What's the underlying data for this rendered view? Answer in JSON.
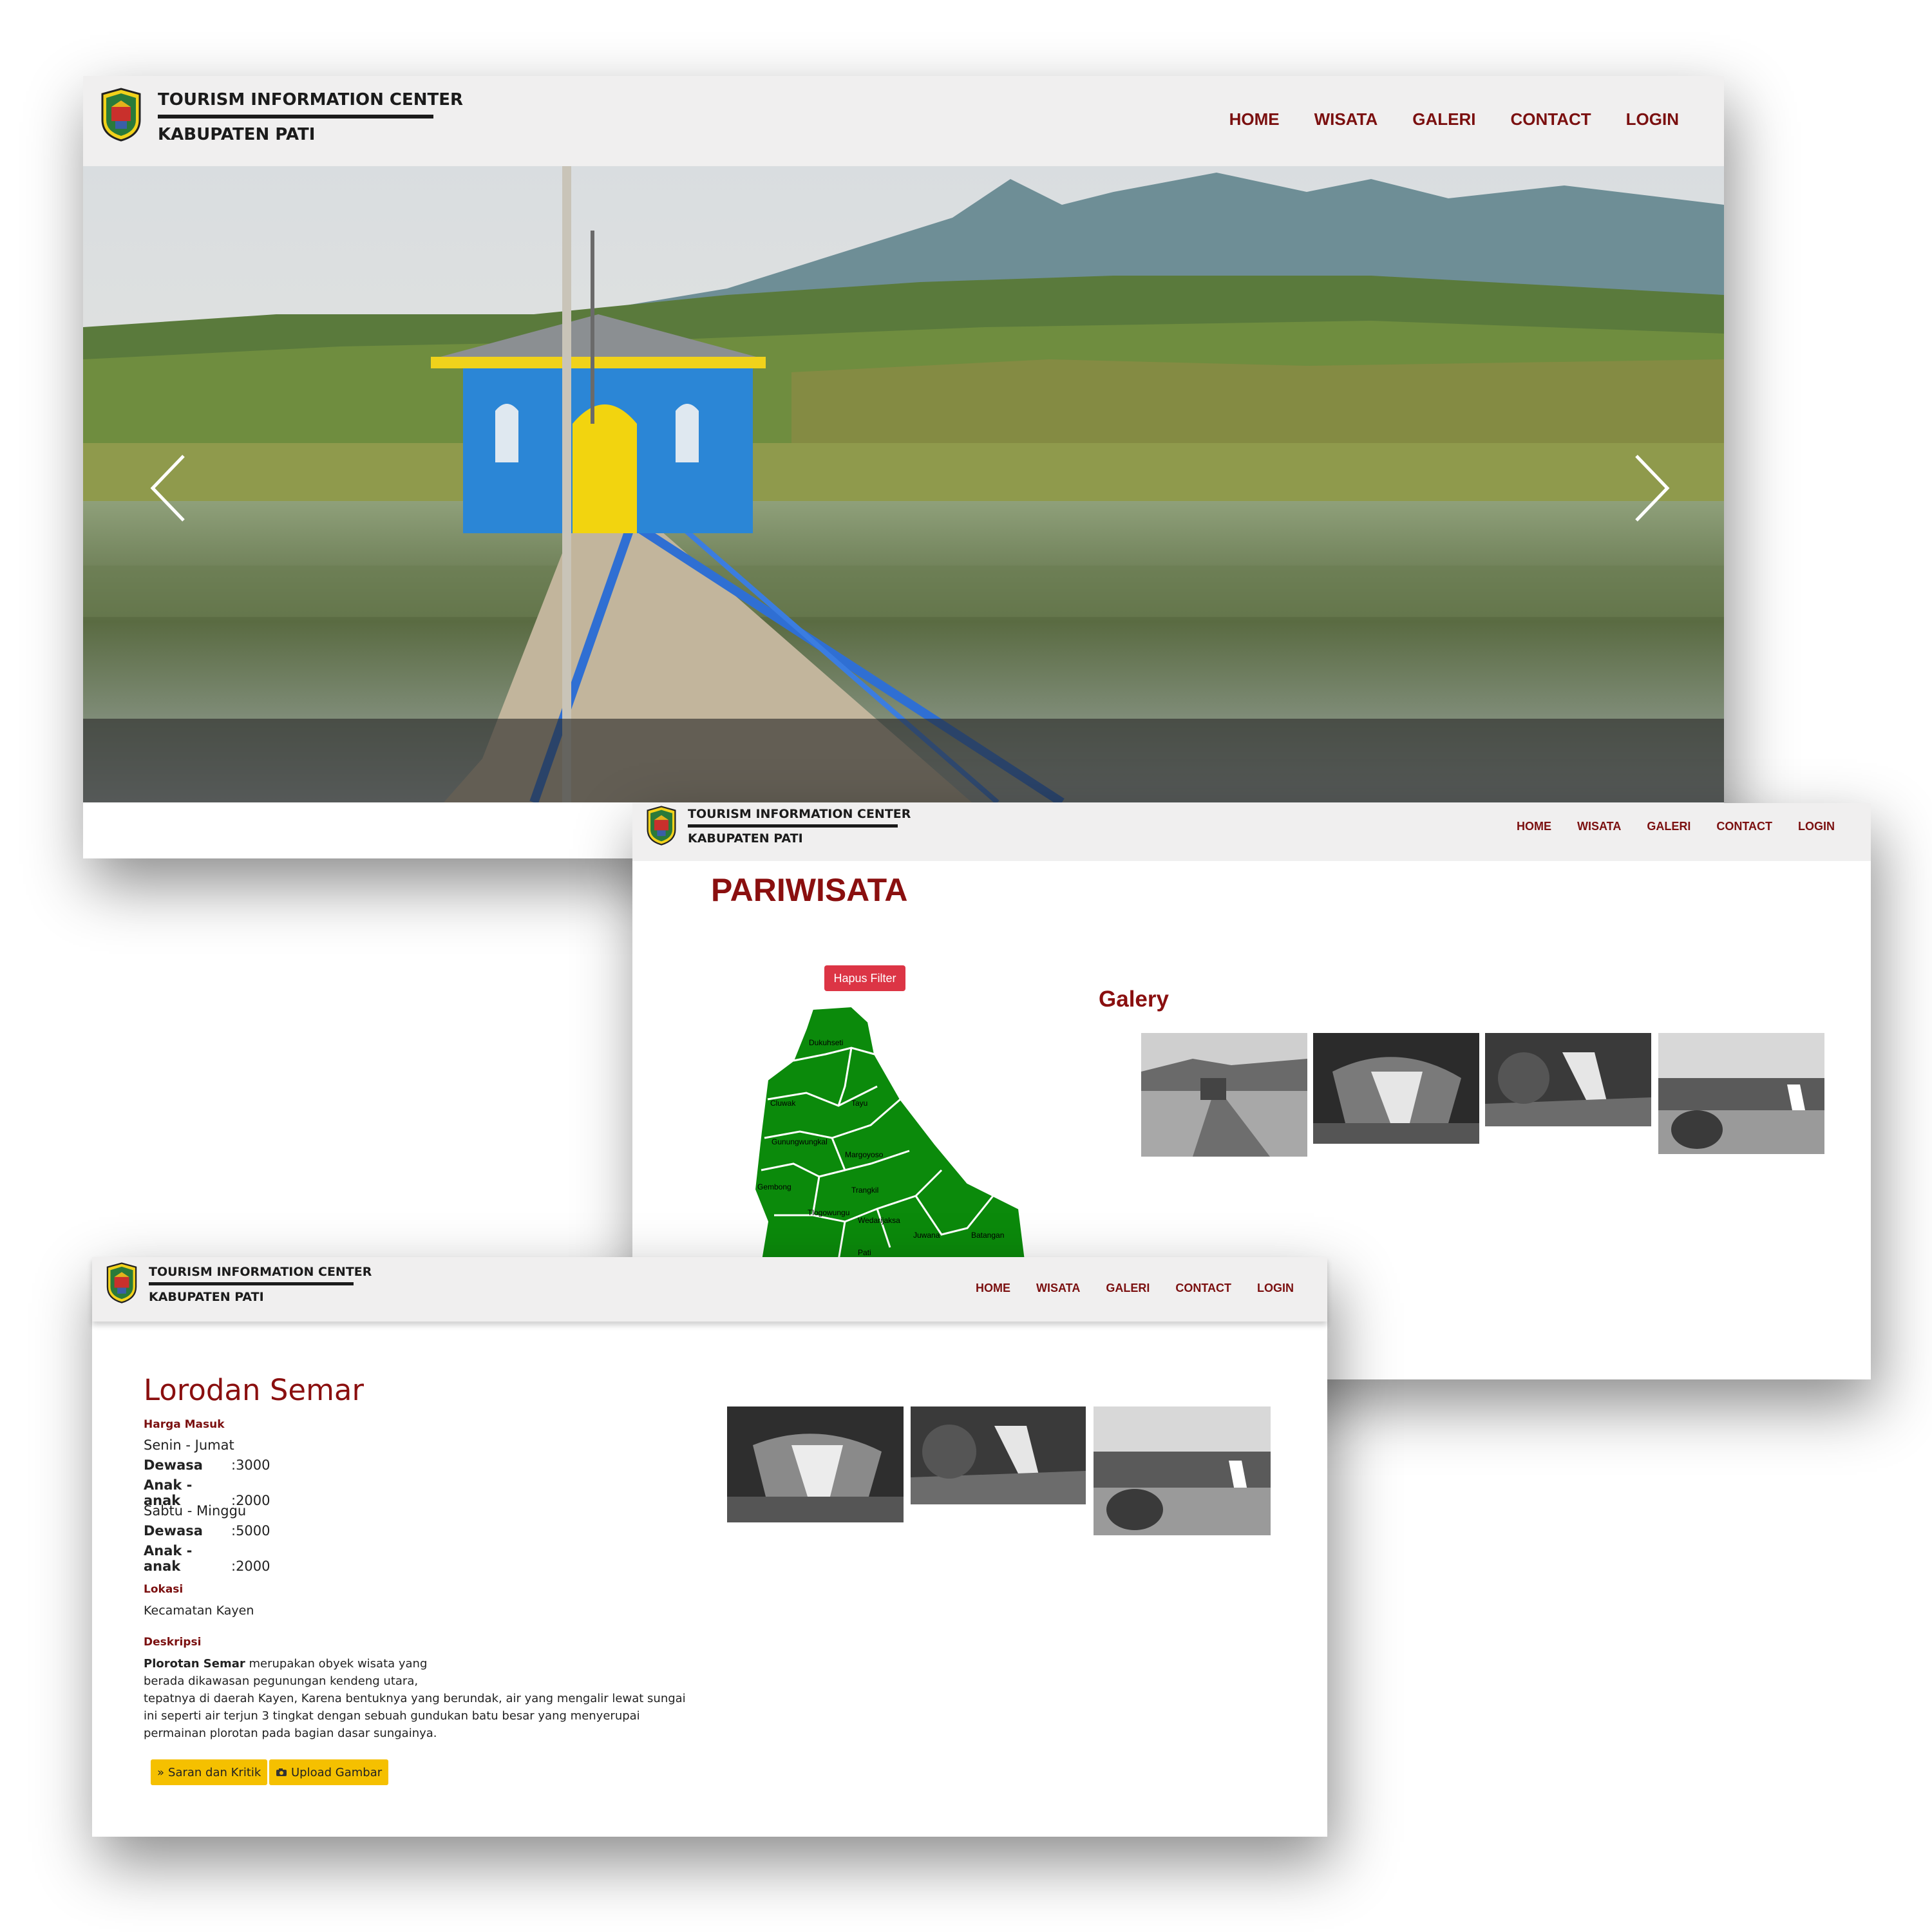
{
  "brand": {
    "line1": "TOURISM INFORMATION CENTER",
    "line2": "KABUPATEN PATI"
  },
  "nav": [
    "HOME",
    "WISATA",
    "GALERI",
    "CONTACT",
    "LOGIN"
  ],
  "pariwisata": {
    "title": "PARIWISATA",
    "clear_filter": "Hapus Filter",
    "galery_title": "Galery",
    "map_labels": [
      "Dukuhseti",
      "Cluwak",
      "Tayu",
      "Gunungwungkal",
      "Margoyoso",
      "Gembong",
      "Tlogowungu",
      "Trangkil",
      "Wedarijaksa",
      "Juwana",
      "Batangan",
      "Pati"
    ]
  },
  "detail": {
    "title": "Lorodan Semar",
    "harga_label": "Harga Masuk",
    "weekday_label": "Senin - Jumat",
    "weekday_prices": [
      {
        "key": "Dewasa",
        "value": ":3000"
      },
      {
        "key": "Anak - anak",
        "value": ":2000"
      }
    ],
    "weekend_label": "Sabtu - Minggu",
    "weekend_prices": [
      {
        "key": "Dewasa",
        "value": ":5000"
      },
      {
        "key": "Anak - anak",
        "value": ":2000"
      }
    ],
    "lokasi_label": "Lokasi",
    "lokasi_value": "Kecamatan Kayen",
    "deskripsi_label": "Deskripsi",
    "deskripsi_bold": "Plorotan Semar",
    "deskripsi_lines": [
      " merupakan obyek wisata yang",
      "berada dikawasan pegunungan kendeng utara,",
      "tepatnya di daerah Kayen, Karena bentuknya yang berundak, air yang mengalir lewat sungai",
      "ini seperti air terjun 3 tingkat dengan sebuah gundukan batu besar yang menyerupai",
      "permainan plorotan pada bagian dasar sungainya."
    ],
    "btn_saran": "Saran dan Kritik",
    "btn_upload": "Upload Gambar"
  },
  "colors": {
    "nav_text": "#7b1010",
    "title": "#8a0f0f",
    "btn_red": "#dc3545",
    "btn_yellow": "#f5c000",
    "map_green": "#0b8a0b"
  },
  "icons": [
    "logo-emblem-icon",
    "chevron-left-icon",
    "chevron-right-icon",
    "double-chevron-down-icon",
    "camera-icon"
  ]
}
